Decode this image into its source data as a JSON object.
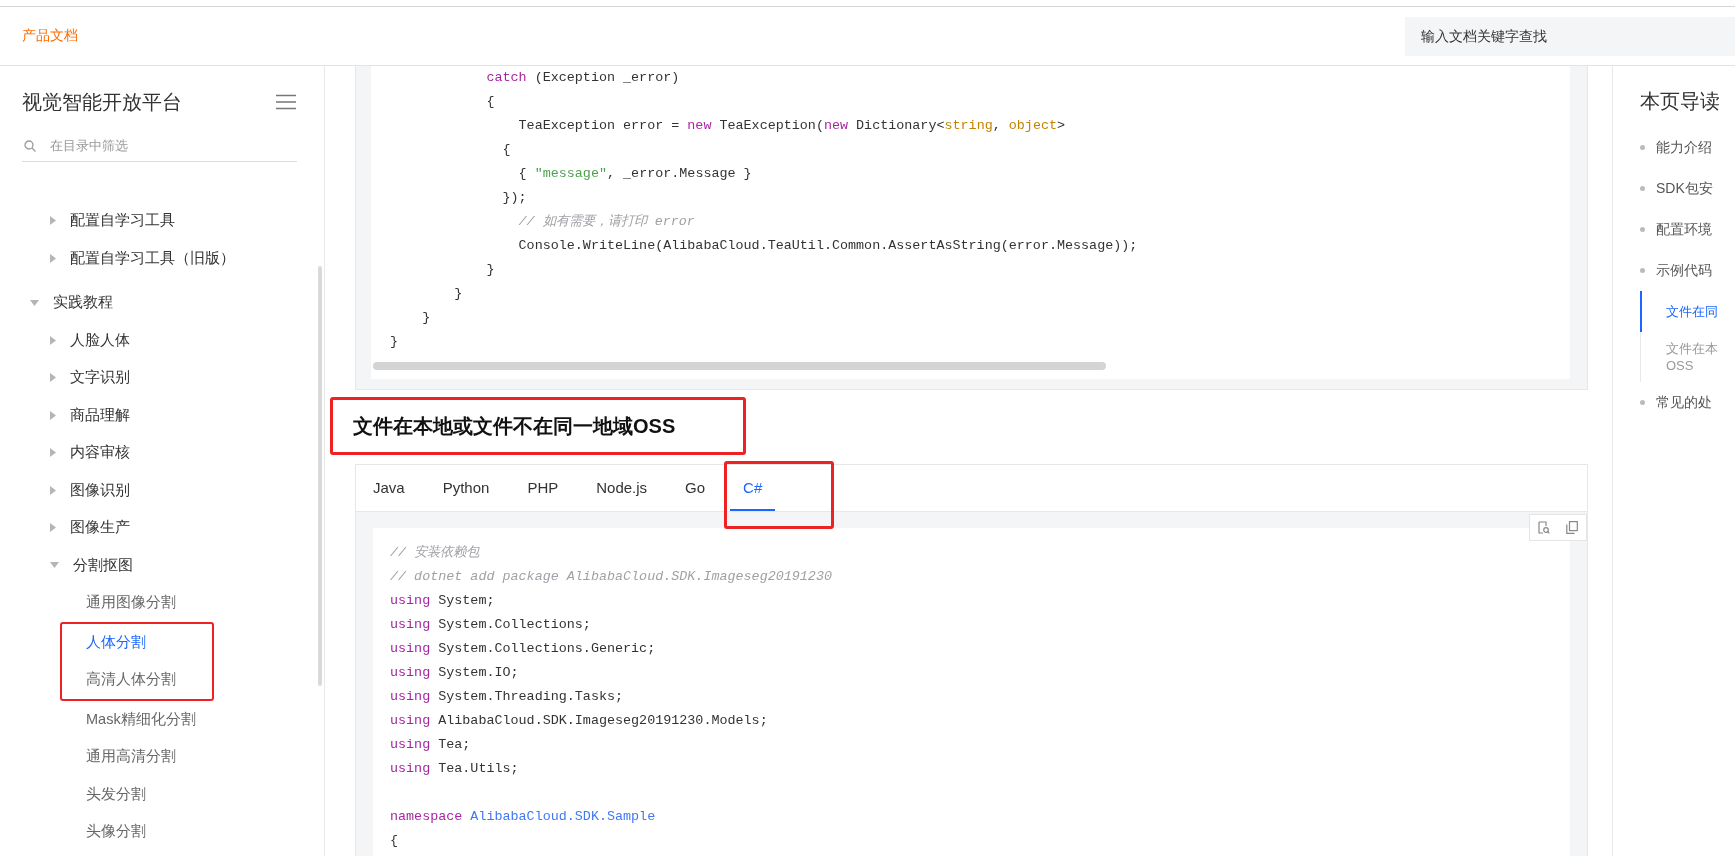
{
  "top_bar": {
    "brand": "产品文档",
    "search": {
      "placeholder": "输入文档关键字查找"
    }
  },
  "sidebar": {
    "title": "视觉智能开放平台",
    "filter": {
      "placeholder": "在目录中筛选"
    },
    "tree": [
      {
        "kind": "offscreen",
        "children": [
          {
            "kind": "folder",
            "label": "配置自学习工具",
            "expanded": false,
            "selected": false
          },
          {
            "kind": "folder",
            "label": "配置自学习工具（旧版）",
            "expanded": false,
            "selected": false
          }
        ]
      },
      {
        "kind": "folder",
        "label": "实践教程",
        "expanded": true,
        "selected": false,
        "children": [
          {
            "kind": "folder",
            "label": "人脸人体",
            "expanded": false,
            "selected": false
          },
          {
            "kind": "folder",
            "label": "文字识别",
            "expanded": false,
            "selected": false
          },
          {
            "kind": "folder",
            "label": "商品理解",
            "expanded": false,
            "selected": false
          },
          {
            "kind": "folder",
            "label": "内容审核",
            "expanded": false,
            "selected": false
          },
          {
            "kind": "folder",
            "label": "图像识别",
            "expanded": false,
            "selected": false
          },
          {
            "kind": "folder",
            "label": "图像生产",
            "expanded": false,
            "selected": false
          },
          {
            "kind": "folder",
            "label": "分割抠图",
            "expanded": true,
            "selected": false,
            "children": [
              {
                "kind": "page",
                "label": "通用图像分割",
                "selected": false
              },
              {
                "kind": "page",
                "label": "人体分割",
                "selected": true,
                "highlighted": true
              },
              {
                "kind": "page",
                "label": "高清人体分割",
                "selected": false,
                "highlighted": true
              },
              {
                "kind": "page",
                "label": "Mask精细化分割",
                "selected": false
              },
              {
                "kind": "page",
                "label": "通用高清分割",
                "selected": false
              },
              {
                "kind": "page",
                "label": "头发分割",
                "selected": false
              },
              {
                "kind": "page",
                "label": "头像分割",
                "selected": false
              }
            ]
          }
        ]
      }
    ]
  },
  "content": {
    "code_above": {
      "lines": [
        {
          "kind": "code",
          "segments": [
            {
              "kind": "keyword",
              "text": "            catch"
            },
            {
              "kind": "plain",
              "text": " (Exception _error)"
            }
          ]
        },
        {
          "kind": "code",
          "segments": [
            {
              "kind": "plain",
              "text": "            {"
            }
          ]
        },
        {
          "kind": "code",
          "segments": [
            {
              "kind": "plain",
              "text": "                TeaException error = "
            },
            {
              "kind": "keyword",
              "text": "new"
            },
            {
              "kind": "plain",
              "text": " TeaException("
            },
            {
              "kind": "keyword",
              "text": "new"
            },
            {
              "kind": "plain",
              "text": " Dictionary<"
            },
            {
              "kind": "type",
              "text": "string"
            },
            {
              "kind": "plain",
              "text": ", "
            },
            {
              "kind": "type",
              "text": "object"
            },
            {
              "kind": "plain",
              "text": ">"
            }
          ]
        },
        {
          "kind": "code",
          "segments": [
            {
              "kind": "plain",
              "text": "              {"
            }
          ]
        },
        {
          "kind": "code",
          "segments": [
            {
              "kind": "plain",
              "text": "                { "
            },
            {
              "kind": "string",
              "text": "\"message\""
            },
            {
              "kind": "plain",
              "text": ", _error.Message }"
            }
          ]
        },
        {
          "kind": "code",
          "segments": [
            {
              "kind": "plain",
              "text": "              });"
            }
          ]
        },
        {
          "kind": "code",
          "segments": [
            {
              "kind": "comment",
              "text": "                // 如有需要，请打印 error"
            }
          ]
        },
        {
          "kind": "code",
          "segments": [
            {
              "kind": "plain",
              "text": "                Console.WriteLine(AlibabaCloud.TeaUtil.Common.AssertAsString(error.Message));"
            }
          ]
        },
        {
          "kind": "code",
          "segments": [
            {
              "kind": "plain",
              "text": "            }"
            }
          ]
        },
        {
          "kind": "code",
          "segments": [
            {
              "kind": "plain",
              "text": "        }"
            }
          ]
        },
        {
          "kind": "code",
          "segments": [
            {
              "kind": "plain",
              "text": "    }"
            }
          ]
        },
        {
          "kind": "code",
          "segments": [
            {
              "kind": "plain",
              "text": "}"
            }
          ]
        }
      ]
    },
    "heading": {
      "text": "文件在本地或文件不在同一地域OSS",
      "highlighted": true
    },
    "tabs": [
      {
        "label": "Java",
        "selected": false
      },
      {
        "label": "Python",
        "selected": false
      },
      {
        "label": "PHP",
        "selected": false
      },
      {
        "label": "Node.js",
        "selected": false
      },
      {
        "label": "Go",
        "selected": false
      },
      {
        "label": "C#",
        "selected": true,
        "highlighted": true
      }
    ],
    "code": {
      "lines": [
        {
          "kind": "code",
          "segments": [
            {
              "kind": "comment",
              "text": "// 安装依赖包"
            }
          ]
        },
        {
          "kind": "code",
          "segments": [
            {
              "kind": "comment",
              "text": "// dotnet add package AlibabaCloud.SDK.Imageseg20191230"
            }
          ]
        },
        {
          "kind": "code",
          "segments": [
            {
              "kind": "keyword",
              "text": "using"
            },
            {
              "kind": "plain",
              "text": " System;"
            }
          ]
        },
        {
          "kind": "code",
          "segments": [
            {
              "kind": "keyword",
              "text": "using"
            },
            {
              "kind": "plain",
              "text": " System.Collections;"
            }
          ]
        },
        {
          "kind": "code",
          "segments": [
            {
              "kind": "keyword",
              "text": "using"
            },
            {
              "kind": "plain",
              "text": " System.Collections.Generic;"
            }
          ]
        },
        {
          "kind": "code",
          "segments": [
            {
              "kind": "keyword",
              "text": "using"
            },
            {
              "kind": "plain",
              "text": " System.IO;"
            }
          ]
        },
        {
          "kind": "code",
          "segments": [
            {
              "kind": "keyword",
              "text": "using"
            },
            {
              "kind": "plain",
              "text": " System.Threading.Tasks;"
            }
          ]
        },
        {
          "kind": "code",
          "segments": [
            {
              "kind": "keyword",
              "text": "using"
            },
            {
              "kind": "plain",
              "text": " AlibabaCloud.SDK.Imageseg20191230.Models;"
            }
          ]
        },
        {
          "kind": "code",
          "segments": [
            {
              "kind": "keyword",
              "text": "using"
            },
            {
              "kind": "plain",
              "text": " Tea;"
            }
          ]
        },
        {
          "kind": "code",
          "segments": [
            {
              "kind": "keyword",
              "text": "using"
            },
            {
              "kind": "plain",
              "text": " Tea.Utils;"
            }
          ]
        },
        {
          "kind": "blank"
        },
        {
          "kind": "code",
          "segments": [
            {
              "kind": "keyword",
              "text": "namespace"
            },
            {
              "kind": "name",
              "text": " AlibabaCloud.SDK.Sample"
            }
          ]
        },
        {
          "kind": "code",
          "segments": [
            {
              "kind": "plain",
              "text": "{"
            }
          ]
        }
      ]
    }
  },
  "page_nav": {
    "title": "本页导读",
    "items": [
      {
        "label": "能力介绍",
        "selected": false
      },
      {
        "label": "SDK包安",
        "selected": false
      },
      {
        "label": "配置环境",
        "selected": false
      },
      {
        "label": "示例代码",
        "selected": false,
        "children": [
          {
            "lines": [
              "文件在同"
            ],
            "selected": true
          },
          {
            "lines": [
              "文件在本",
              "OSS"
            ],
            "selected": false
          }
        ]
      },
      {
        "label": "常见的处",
        "selected": false
      }
    ]
  }
}
